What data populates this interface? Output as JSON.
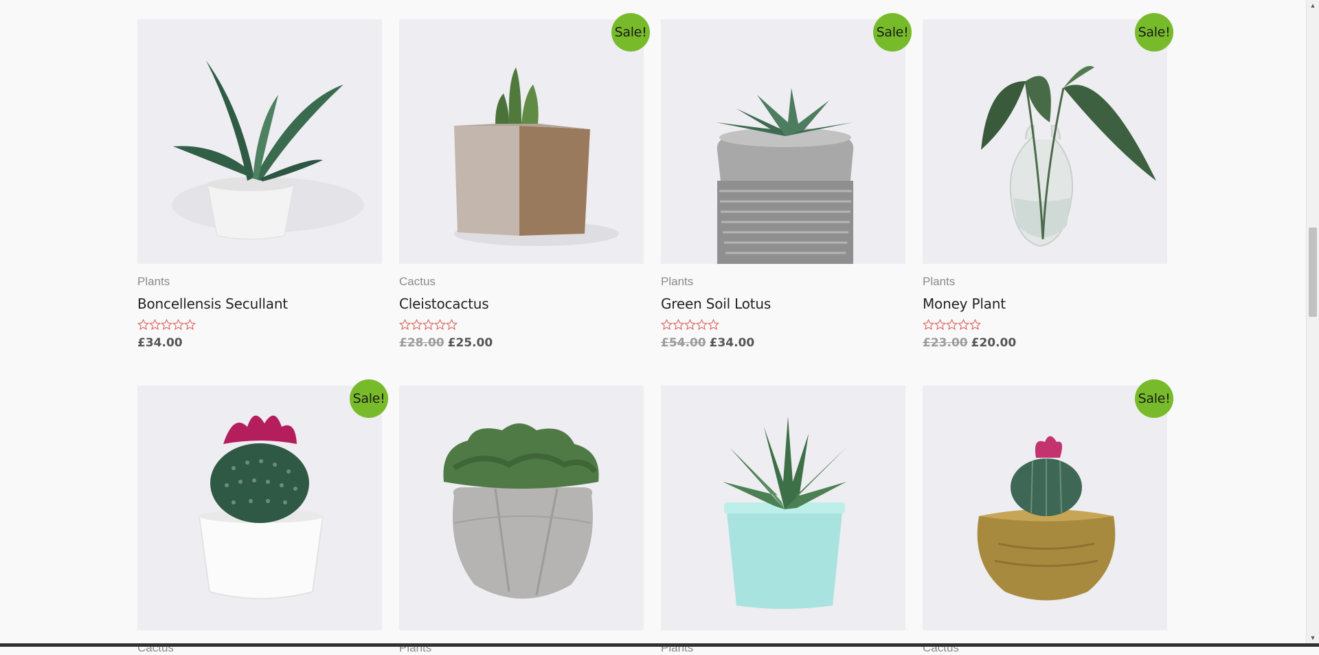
{
  "products": [
    {
      "category": "Plants",
      "title": "Boncellensis Secullant",
      "sale": false,
      "old_price": "",
      "price": "£34.00",
      "image": "aloe-white-pot",
      "rating": 0
    },
    {
      "category": "Cactus",
      "title": "Cleistocactus",
      "sale": true,
      "old_price": "£28.00",
      "price": "£25.00",
      "image": "cactus-square-pot",
      "rating": 0
    },
    {
      "category": "Plants",
      "title": "Green Soil Lotus",
      "sale": true,
      "old_price": "£54.00",
      "price": "£34.00",
      "image": "succulent-stone-pot",
      "rating": 0
    },
    {
      "category": "Plants",
      "title": "Money Plant",
      "sale": true,
      "old_price": "£23.00",
      "price": "£20.00",
      "image": "leaves-glass-vase",
      "rating": 0
    },
    {
      "category": "Cactus",
      "title": "",
      "sale": true,
      "old_price": "",
      "price": "",
      "image": "flowering-cactus-white-pot",
      "rating": 0
    },
    {
      "category": "Plants",
      "title": "",
      "sale": false,
      "old_price": "",
      "price": "",
      "image": "moss-concrete-pot",
      "rating": 0
    },
    {
      "category": "Plants",
      "title": "",
      "sale": false,
      "old_price": "",
      "price": "",
      "image": "haworthia-mint-pot",
      "rating": 0
    },
    {
      "category": "Cactus",
      "title": "",
      "sale": true,
      "old_price": "",
      "price": "",
      "image": "cactus-brass-pot",
      "rating": 0
    }
  ],
  "sale_label": "Sale!",
  "colors": {
    "sale_badge": "#77bb2a",
    "star_outline": "#d9645e",
    "image_bg": "#eeedf1",
    "page_bg": "#f9f9f9"
  }
}
